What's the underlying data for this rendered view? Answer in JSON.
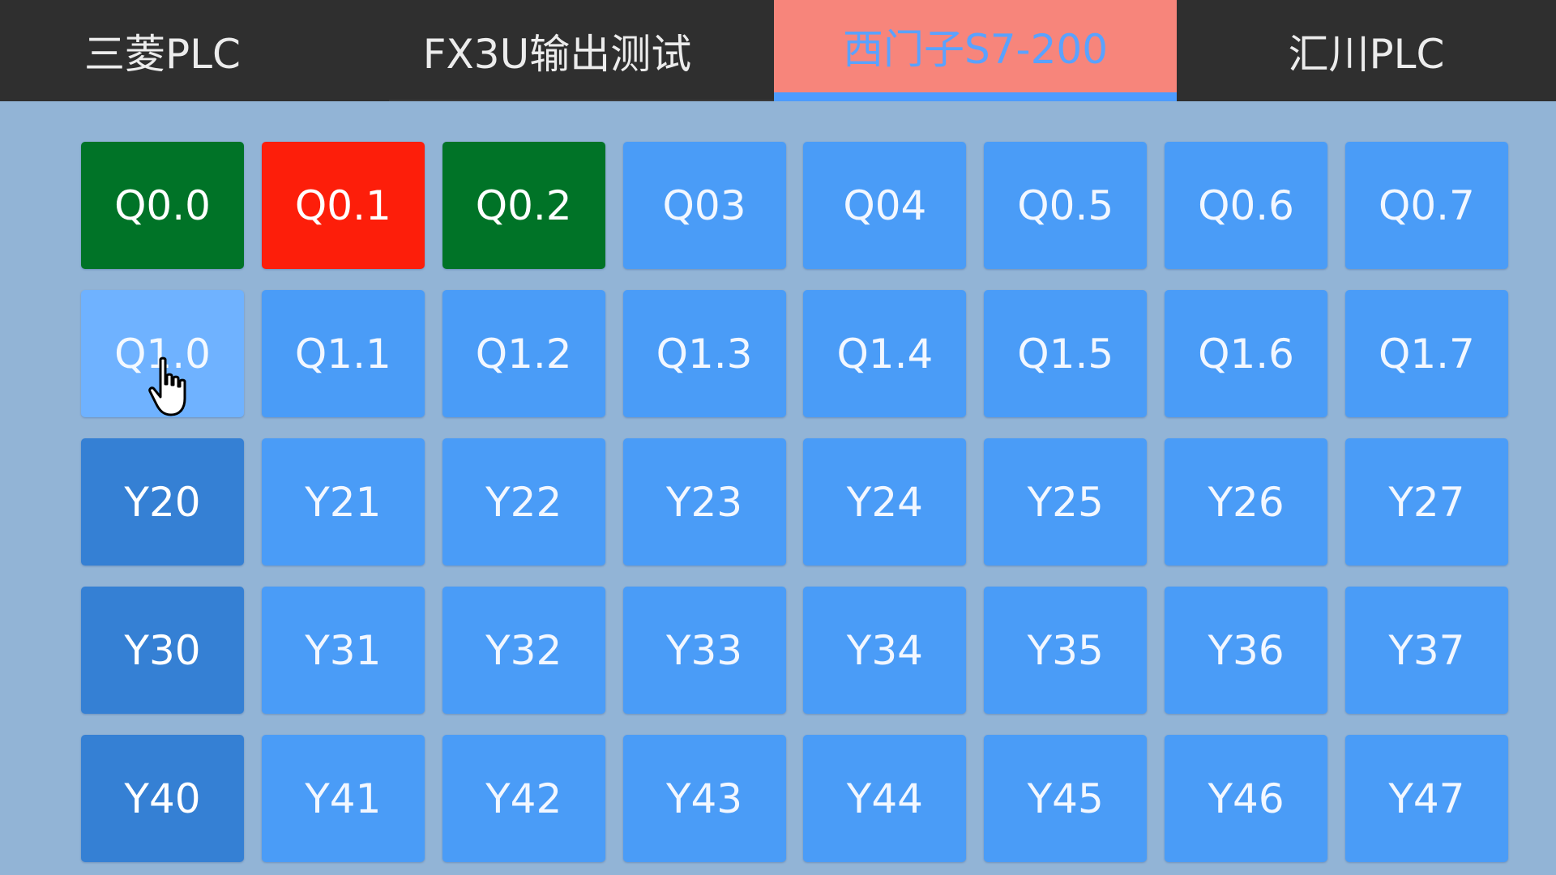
{
  "tabs": [
    {
      "label": "三菱PLC",
      "active": false
    },
    {
      "label": "FX3U输出测试",
      "active": false
    },
    {
      "label": "西门子S7-200",
      "active": true
    },
    {
      "label": "汇川PLC",
      "active": false
    }
  ],
  "colors": {
    "background": "#92b4d6",
    "tabbar": "#2f2f2f",
    "tab_active": "#f7857b",
    "tab_active_text": "#5aa2ff",
    "button_default": "#4a9cf7",
    "button_on": "#007327",
    "button_alarm": "#fd1e0a",
    "button_dark": "#3580d4",
    "button_hover": "#6fb2ff"
  },
  "outputs": [
    [
      {
        "label": "Q0.0",
        "state": "on"
      },
      {
        "label": "Q0.1",
        "state": "alarm"
      },
      {
        "label": "Q0.2",
        "state": "on"
      },
      {
        "label": "Q03",
        "state": "default"
      },
      {
        "label": "Q04",
        "state": "default"
      },
      {
        "label": "Q0.5",
        "state": "default"
      },
      {
        "label": "Q0.6",
        "state": "default"
      },
      {
        "label": "Q0.7",
        "state": "default"
      }
    ],
    [
      {
        "label": "Q1.0",
        "state": "hover"
      },
      {
        "label": "Q1.1",
        "state": "default"
      },
      {
        "label": "Q1.2",
        "state": "default"
      },
      {
        "label": "Q1.3",
        "state": "default"
      },
      {
        "label": "Q1.4",
        "state": "default"
      },
      {
        "label": "Q1.5",
        "state": "default"
      },
      {
        "label": "Q1.6",
        "state": "default"
      },
      {
        "label": "Q1.7",
        "state": "default"
      }
    ],
    [
      {
        "label": "Y20",
        "state": "dark"
      },
      {
        "label": "Y21",
        "state": "default"
      },
      {
        "label": "Y22",
        "state": "default"
      },
      {
        "label": "Y23",
        "state": "default"
      },
      {
        "label": "Y24",
        "state": "default"
      },
      {
        "label": "Y25",
        "state": "default"
      },
      {
        "label": "Y26",
        "state": "default"
      },
      {
        "label": "Y27",
        "state": "default"
      }
    ],
    [
      {
        "label": "Y30",
        "state": "dark"
      },
      {
        "label": "Y31",
        "state": "default"
      },
      {
        "label": "Y32",
        "state": "default"
      },
      {
        "label": "Y33",
        "state": "default"
      },
      {
        "label": "Y34",
        "state": "default"
      },
      {
        "label": "Y35",
        "state": "default"
      },
      {
        "label": "Y36",
        "state": "default"
      },
      {
        "label": "Y37",
        "state": "default"
      }
    ],
    [
      {
        "label": "Y40",
        "state": "dark"
      },
      {
        "label": "Y41",
        "state": "default"
      },
      {
        "label": "Y42",
        "state": "default"
      },
      {
        "label": "Y43",
        "state": "default"
      },
      {
        "label": "Y44",
        "state": "default"
      },
      {
        "label": "Y45",
        "state": "default"
      },
      {
        "label": "Y46",
        "state": "default"
      },
      {
        "label": "Y47",
        "state": "default"
      }
    ]
  ],
  "cursor": {
    "icon": "hand-pointer-icon"
  }
}
